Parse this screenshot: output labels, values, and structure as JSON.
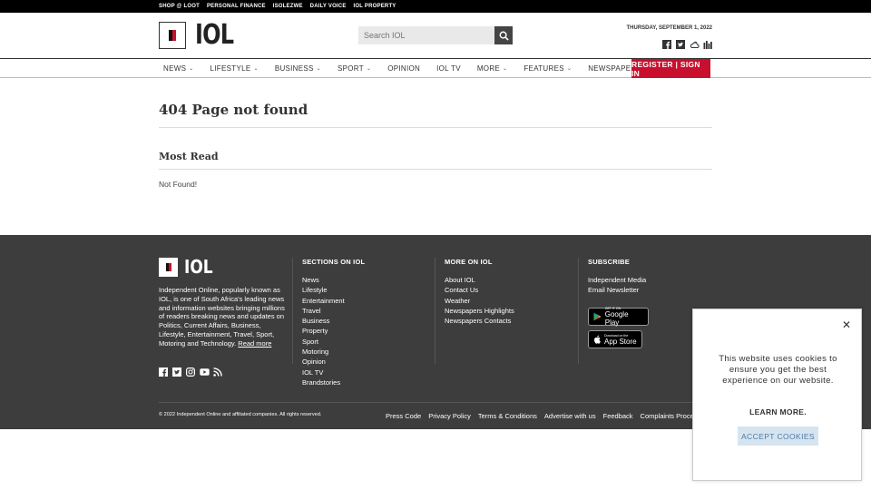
{
  "topbar": {
    "links": [
      "SHOP @ LOOT",
      "PERSONAL FINANCE",
      "ISOLEZWE",
      "DAILY VOICE",
      "IOL PROPERTY"
    ]
  },
  "header": {
    "logo_text": "IOL",
    "search_placeholder": "Search IOL",
    "date": "THURSDAY, SEPTEMBER 1, 2022",
    "social_icons": [
      "facebook-icon",
      "twitter-icon",
      "weather-icon",
      "markets-icon"
    ]
  },
  "nav": {
    "items": [
      {
        "label": "NEWS",
        "dropdown": true
      },
      {
        "label": "LIFESTYLE",
        "dropdown": true
      },
      {
        "label": "BUSINESS",
        "dropdown": true
      },
      {
        "label": "SPORT",
        "dropdown": true
      },
      {
        "label": "OPINION",
        "dropdown": false
      },
      {
        "label": "IOL TV",
        "dropdown": false
      },
      {
        "label": "MORE",
        "dropdown": true
      },
      {
        "label": "FEATURES",
        "dropdown": true
      },
      {
        "label": "NEWSPAPERS",
        "dropdown": true
      }
    ],
    "register_label": "REGISTER | SIGN IN"
  },
  "main": {
    "title": "404 Page not found",
    "most_read_heading": "Most Read",
    "most_read_text": "Not Found!"
  },
  "footer": {
    "logo_text": "IOL",
    "about": "Independent Online, popularly known as IOL, is one of South Africa's leading news and information websites bringing millions of readers breaking news and updates on Politics, Current Affairs, Business, Lifestyle, Entertainment, Travel, Sport, Motoring and Technology.",
    "read_more": "Read more",
    "social_icons": [
      "facebook-icon",
      "twitter-icon",
      "instagram-icon",
      "youtube-icon",
      "rss-icon"
    ],
    "sections_heading": "SECTIONS ON IOL",
    "sections": [
      "News",
      "Lifestyle",
      "Entertainment",
      "Travel",
      "Business",
      "Property",
      "Sport",
      "Motoring",
      "Opinion",
      "IOL TV",
      "Brandstories"
    ],
    "more_heading": "MORE ON IOL",
    "more": [
      "About IOL",
      "Contact Us",
      "Weather",
      "Newspapers Highlights",
      "Newspapers Contacts"
    ],
    "subscribe_heading": "SUBSCRIBE",
    "subscribe": [
      "Independent Media",
      "Email Newsletter"
    ],
    "google_play_small": "GET IT ON",
    "google_play_big": "Google Play",
    "app_store_small": "Download on the",
    "app_store_big": "App Store",
    "copyright": "© 2022 Independent Online and affiliated companies. All rights reserved.",
    "bottom_links": [
      "Press Code",
      "Privacy Policy",
      "Terms & Conditions",
      "Advertise with us",
      "Feedback",
      "Complaints Procedure"
    ]
  },
  "cookie": {
    "message": "This website uses cookies to ensure you get the best experience on our website.",
    "learn_more": "LEARN MORE.",
    "accept": "ACCEPT COOKIES"
  }
}
